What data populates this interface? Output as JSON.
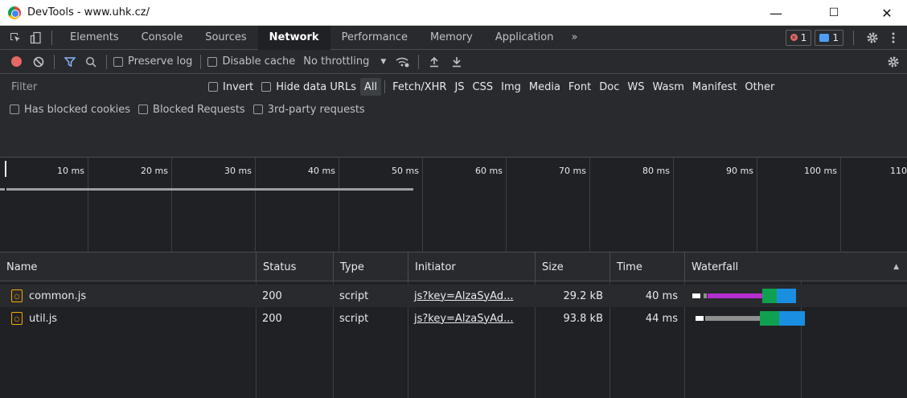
{
  "window": {
    "title": "DevTools - www.uhk.cz/",
    "minimize": "—",
    "maximize": "☐",
    "close": "✕"
  },
  "tabs": [
    {
      "label": "Elements",
      "active": false
    },
    {
      "label": "Console",
      "active": false
    },
    {
      "label": "Sources",
      "active": false
    },
    {
      "label": "Network",
      "active": true
    },
    {
      "label": "Performance",
      "active": false
    },
    {
      "label": "Memory",
      "active": false
    },
    {
      "label": "Application",
      "active": false
    }
  ],
  "tabs_more": "»",
  "badges": {
    "errors": "1",
    "messages": "1"
  },
  "toolbar": {
    "preserve_log": "Preserve log",
    "disable_cache": "Disable cache",
    "throttling": "No throttling",
    "throttle_arrow": "▼"
  },
  "filter": {
    "placeholder": "Filter",
    "invert": "Invert",
    "hide_data_urls": "Hide data URLs",
    "types": [
      "All",
      "Fetch/XHR",
      "JS",
      "CSS",
      "Img",
      "Media",
      "Font",
      "Doc",
      "WS",
      "Wasm",
      "Manifest",
      "Other"
    ],
    "active_type": "All"
  },
  "blocked": {
    "has_blocked_cookies": "Has blocked cookies",
    "blocked_requests": "Blocked Requests",
    "third_party": "3rd-party requests"
  },
  "overview": {
    "ticks": [
      "10 ms",
      "20 ms",
      "30 ms",
      "40 ms",
      "50 ms",
      "60 ms",
      "70 ms",
      "80 ms",
      "90 ms",
      "100 ms",
      "110"
    ]
  },
  "table": {
    "headers": [
      "Name",
      "Status",
      "Type",
      "Initiator",
      "Size",
      "Time",
      "Waterfall"
    ],
    "sort_indicator": "▲",
    "rows": [
      {
        "name": "common.js",
        "status": "200",
        "type": "script",
        "initiator": "js?key=AlzaSyAd...",
        "size": "29.2 kB",
        "time": "40 ms"
      },
      {
        "name": "util.js",
        "status": "200",
        "type": "script",
        "initiator": "js?key=AlzaSyAd...",
        "size": "93.8 kB",
        "time": "44 ms"
      }
    ]
  },
  "colors": {
    "waterfall_queue": "#ffffff",
    "waterfall_wait_purple": "#b52fd0",
    "waterfall_wait_gray": "#8f8f8f",
    "waterfall_ttfb": "#0fa14f",
    "waterfall_download": "#1a8fe2"
  }
}
